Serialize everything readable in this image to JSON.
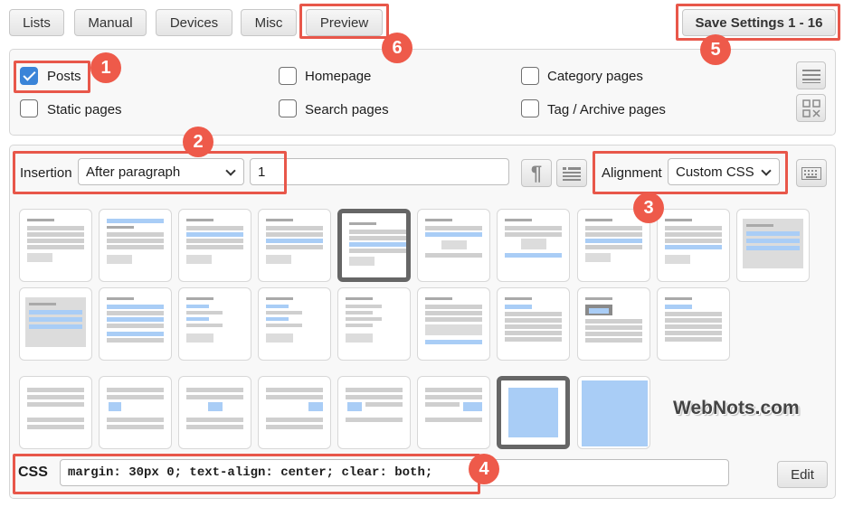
{
  "tabs": [
    "Lists",
    "Manual",
    "Devices",
    "Misc",
    "Preview"
  ],
  "save_button": "Save Settings 1 - 16",
  "badges": [
    "1",
    "2",
    "3",
    "4",
    "5",
    "6"
  ],
  "pages": {
    "posts": {
      "label": "Posts",
      "checked": true
    },
    "homepage": {
      "label": "Homepage",
      "checked": false
    },
    "category": {
      "label": "Category pages",
      "checked": false
    },
    "static": {
      "label": "Static pages",
      "checked": false
    },
    "search": {
      "label": "Search pages",
      "checked": false
    },
    "tag": {
      "label": "Tag / Archive pages",
      "checked": false
    }
  },
  "insertion": {
    "label": "Insertion",
    "value": "After paragraph",
    "paragraph_number": "1"
  },
  "alignment": {
    "label": "Alignment",
    "value": "Custom CSS"
  },
  "css": {
    "label": "CSS",
    "value": "margin: 30px 0; text-align: center; clear: both;",
    "edit_label": "Edit"
  },
  "watermark": "WebNots.com",
  "colors": {
    "highlight": "#e8574a",
    "badge": "#ee5a4a",
    "checkbox": "#3a84d8",
    "preview_blue": "#a9cdf6"
  },
  "icons": [
    "list-lines-icon",
    "grid-toggle-icon",
    "paragraph-icon",
    "list-view-icon",
    "keyboard-icon",
    "checkmark-icon",
    "chevron-down-icon"
  ],
  "alignment_thumbnails": {
    "row1_count": 10,
    "row2_count": 9,
    "row3_count": 8,
    "selected": [
      "thumb-5",
      "thumb-26"
    ]
  }
}
